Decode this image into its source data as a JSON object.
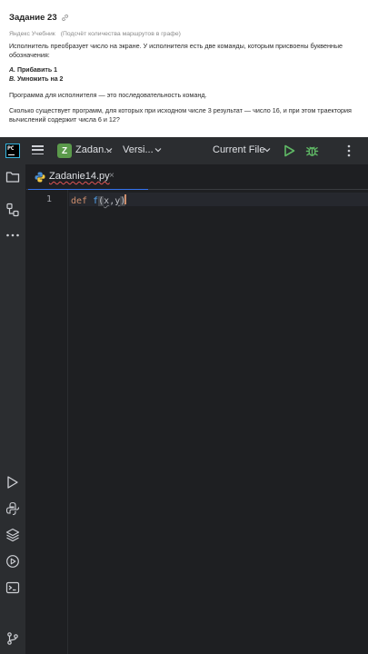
{
  "task": {
    "title": "Задание 23",
    "source": "Яндекс Учебник",
    "topic": "(Подсчёт количества маршрутов в графе)",
    "intro": "Исполнитель преобразует число на экране. У исполнителя есть две команды, которым присвоены буквенные обозначения:",
    "command_a_letter": "А.",
    "command_a": "Прибавить 1",
    "command_b_letter": "В.",
    "command_b": "Умножить на 2",
    "program_def": "Программа для исполнителя — это последовательность команд.",
    "question": "Сколько существует программ, для которых при исходном числе 3 результат — число 16, и при этом траектория вычислений содержит числа 6 и 12?"
  },
  "ide": {
    "logo_text": "PC",
    "project_initial": "Z",
    "project_name": "Zadan...",
    "vcs_label": "Versi...",
    "run_config": "Current File",
    "tab_label": "Zadanie14.py",
    "tab_close": "×",
    "line_numbers": [
      "1"
    ],
    "code": {
      "kw": "def",
      "fn": "f",
      "open": "(",
      "p1": "x",
      "comma": ",",
      "p2": "y",
      "close": ")"
    },
    "icons": {
      "project": "folder-icon",
      "structure": "structure-icon",
      "more": "more-tools-icon",
      "run_panel": "run-panel-icon",
      "python_console": "python-console-icon",
      "packages": "python-packages-icon",
      "services": "services-icon",
      "terminal": "terminal-icon",
      "vcs": "git-branch-icon"
    },
    "colors": {
      "accent": "#3574f0",
      "run": "#5fb865",
      "debug": "#5fb865",
      "project_badge": "#5b9a4b"
    }
  }
}
